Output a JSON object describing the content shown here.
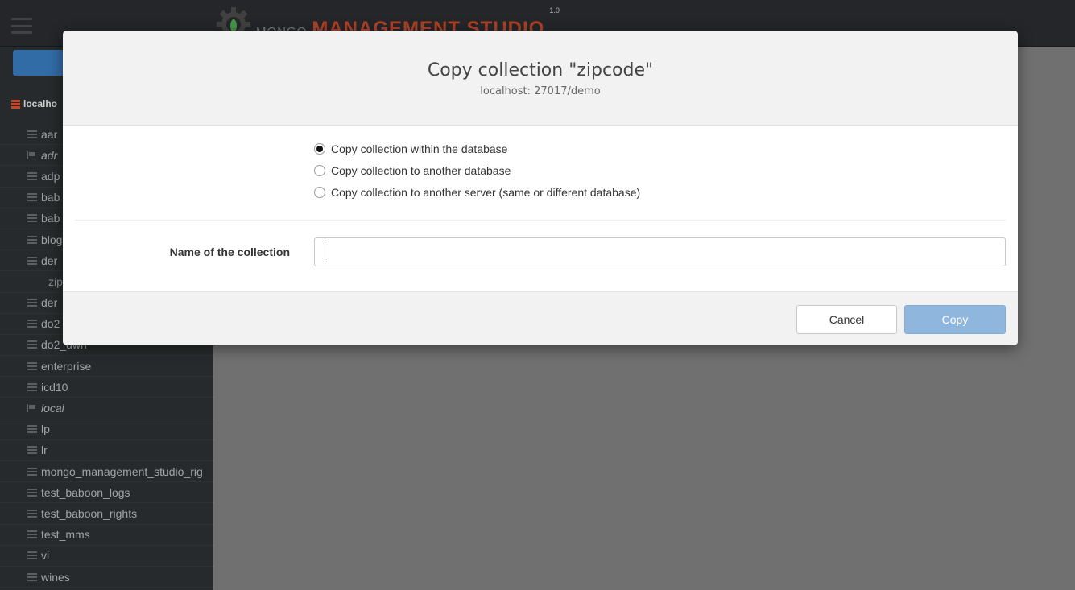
{
  "app": {
    "brand_prefix": "MONGO",
    "brand_name": "MANAGEMENT STUDIO",
    "version": "1.0",
    "brand_color": "#c84a2c",
    "menu_icon": "hamburger-menu-icon"
  },
  "sidebar": {
    "server_label": "localho",
    "databases": [
      {
        "label": "aar",
        "icon": "database-icon",
        "style": "normal"
      },
      {
        "label": "adr",
        "icon": "flag-icon",
        "style": "italic"
      },
      {
        "label": "adp",
        "icon": "database-icon",
        "style": "normal"
      },
      {
        "label": "bab",
        "icon": "database-icon",
        "style": "normal"
      },
      {
        "label": "bab",
        "icon": "database-icon",
        "style": "normal"
      },
      {
        "label": "blog",
        "icon": "database-icon",
        "style": "normal"
      },
      {
        "label": "der",
        "icon": "database-icon",
        "style": "normal"
      },
      {
        "label": "zip",
        "icon": "",
        "style": "sub"
      },
      {
        "label": "der",
        "icon": "database-icon",
        "style": "normal"
      },
      {
        "label": "do2",
        "icon": "database-icon",
        "style": "normal"
      },
      {
        "label": "do2_dwh",
        "icon": "database-icon",
        "style": "normal"
      },
      {
        "label": "enterprise",
        "icon": "database-icon",
        "style": "normal"
      },
      {
        "label": "icd10",
        "icon": "database-icon",
        "style": "normal"
      },
      {
        "label": "local",
        "icon": "flag-icon",
        "style": "italic"
      },
      {
        "label": "lp",
        "icon": "database-icon",
        "style": "normal"
      },
      {
        "label": "lr",
        "icon": "database-icon",
        "style": "normal"
      },
      {
        "label": "mongo_management_studio_rig",
        "icon": "database-icon",
        "style": "normal"
      },
      {
        "label": "test_baboon_logs",
        "icon": "database-icon",
        "style": "normal"
      },
      {
        "label": "test_baboon_rights",
        "icon": "database-icon",
        "style": "normal"
      },
      {
        "label": "test_mms",
        "icon": "database-icon",
        "style": "normal"
      },
      {
        "label": "vi",
        "icon": "database-icon",
        "style": "normal"
      },
      {
        "label": "wines",
        "icon": "database-icon",
        "style": "normal"
      }
    ]
  },
  "modal": {
    "title": "Copy collection \"zipcode\"",
    "subtitle": "localhost: 27017/demo",
    "options": [
      {
        "label": "Copy collection within the database",
        "checked": true
      },
      {
        "label": "Copy collection to another database",
        "checked": false
      },
      {
        "label": "Copy collection to another server (same or different database)",
        "checked": false
      }
    ],
    "name_label": "Name of the collection",
    "name_value": "",
    "cancel_label": "Cancel",
    "copy_label": "Copy",
    "copy_color": "#8fb6dd"
  }
}
